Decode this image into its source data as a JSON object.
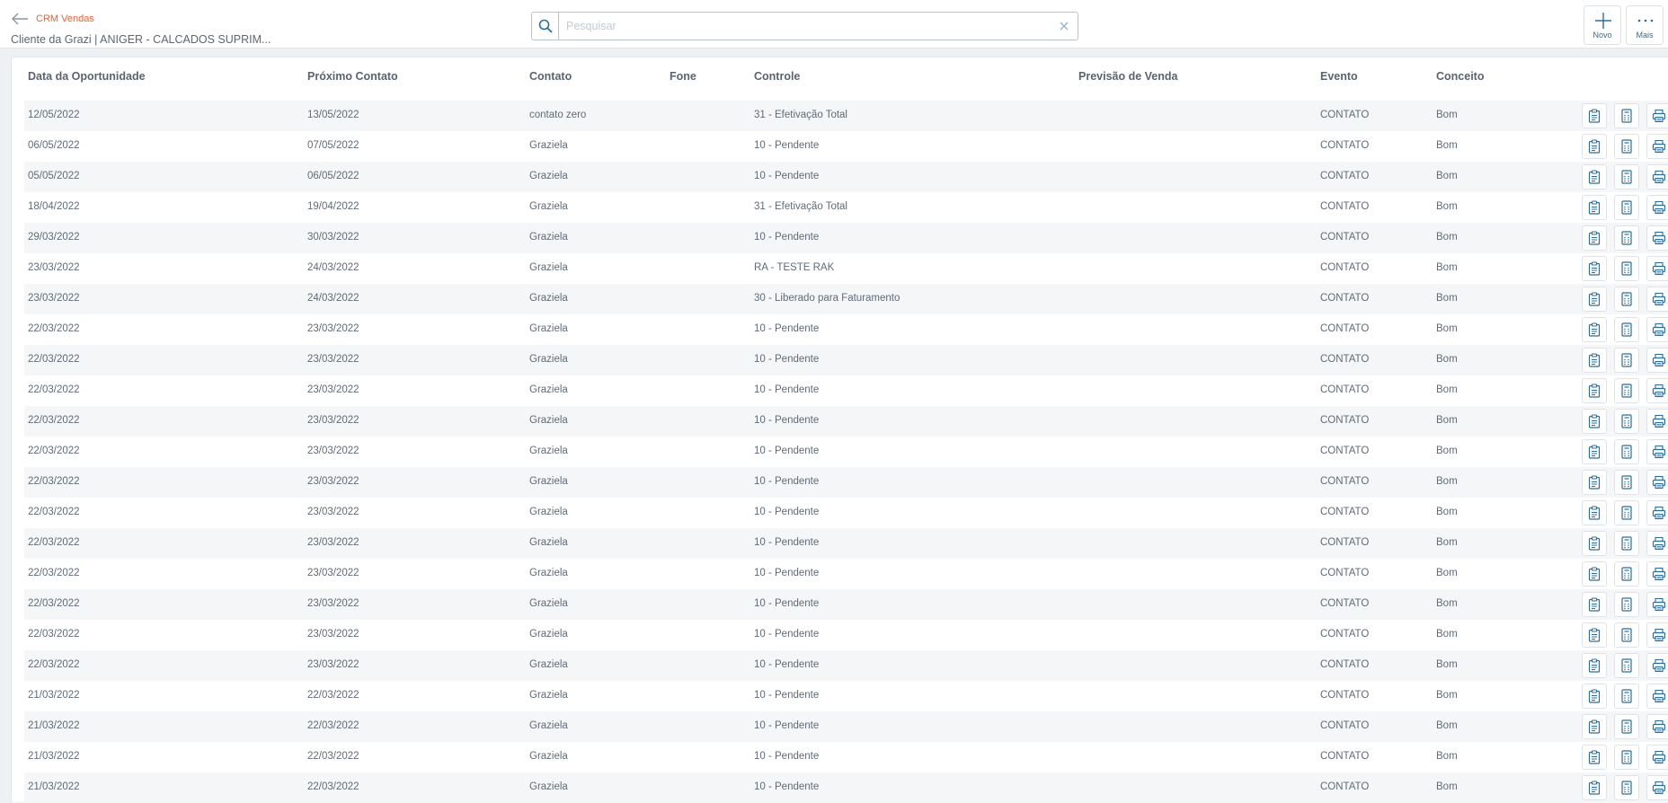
{
  "header": {
    "app_title": "CRM Vendas",
    "subtitle": "Cliente da Grazi | ANIGER - CALCADOS SUPRIM...",
    "search_placeholder": "Pesquisar",
    "novo_label": "Novo",
    "mais_label": "Mais"
  },
  "table": {
    "columns": [
      "Data da Oportunidade",
      "Próximo Contato",
      "Contato",
      "Fone",
      "Controle",
      "Previsão de Venda",
      "Evento",
      "Conceito"
    ],
    "rows": [
      [
        "12/05/2022",
        "13/05/2022",
        "contato zero",
        "",
        "31 - Efetivação Total",
        "",
        "CONTATO",
        "Bom"
      ],
      [
        "06/05/2022",
        "07/05/2022",
        "Graziela",
        "",
        "10 - Pendente",
        "",
        "CONTATO",
        "Bom"
      ],
      [
        "05/05/2022",
        "06/05/2022",
        "Graziela",
        "",
        "10 - Pendente",
        "",
        "CONTATO",
        "Bom"
      ],
      [
        "18/04/2022",
        "19/04/2022",
        "Graziela",
        "",
        "31 - Efetivação Total",
        "",
        "CONTATO",
        "Bom"
      ],
      [
        "29/03/2022",
        "30/03/2022",
        "Graziela",
        "",
        "10 - Pendente",
        "",
        "CONTATO",
        "Bom"
      ],
      [
        "23/03/2022",
        "24/03/2022",
        "Graziela",
        "",
        "RA - TESTE RAK",
        "",
        "CONTATO",
        "Bom"
      ],
      [
        "23/03/2022",
        "24/03/2022",
        "Graziela",
        "",
        "30 - Liberado para Faturamento",
        "",
        "CONTATO",
        "Bom"
      ],
      [
        "22/03/2022",
        "23/03/2022",
        "Graziela",
        "",
        "10 - Pendente",
        "",
        "CONTATO",
        "Bom"
      ],
      [
        "22/03/2022",
        "23/03/2022",
        "Graziela",
        "",
        "10 - Pendente",
        "",
        "CONTATO",
        "Bom"
      ],
      [
        "22/03/2022",
        "23/03/2022",
        "Graziela",
        "",
        "10 - Pendente",
        "",
        "CONTATO",
        "Bom"
      ],
      [
        "22/03/2022",
        "23/03/2022",
        "Graziela",
        "",
        "10 - Pendente",
        "",
        "CONTATO",
        "Bom"
      ],
      [
        "22/03/2022",
        "23/03/2022",
        "Graziela",
        "",
        "10 - Pendente",
        "",
        "CONTATO",
        "Bom"
      ],
      [
        "22/03/2022",
        "23/03/2022",
        "Graziela",
        "",
        "10 - Pendente",
        "",
        "CONTATO",
        "Bom"
      ],
      [
        "22/03/2022",
        "23/03/2022",
        "Graziela",
        "",
        "10 - Pendente",
        "",
        "CONTATO",
        "Bom"
      ],
      [
        "22/03/2022",
        "23/03/2022",
        "Graziela",
        "",
        "10 - Pendente",
        "",
        "CONTATO",
        "Bom"
      ],
      [
        "22/03/2022",
        "23/03/2022",
        "Graziela",
        "",
        "10 - Pendente",
        "",
        "CONTATO",
        "Bom"
      ],
      [
        "22/03/2022",
        "23/03/2022",
        "Graziela",
        "",
        "10 - Pendente",
        "",
        "CONTATO",
        "Bom"
      ],
      [
        "22/03/2022",
        "23/03/2022",
        "Graziela",
        "",
        "10 - Pendente",
        "",
        "CONTATO",
        "Bom"
      ],
      [
        "22/03/2022",
        "23/03/2022",
        "Graziela",
        "",
        "10 - Pendente",
        "",
        "CONTATO",
        "Bom"
      ],
      [
        "21/03/2022",
        "22/03/2022",
        "Graziela",
        "",
        "10 - Pendente",
        "",
        "CONTATO",
        "Bom"
      ],
      [
        "21/03/2022",
        "22/03/2022",
        "Graziela",
        "",
        "10 - Pendente",
        "",
        "CONTATO",
        "Bom"
      ],
      [
        "21/03/2022",
        "22/03/2022",
        "Graziela",
        "",
        "10 - Pendente",
        "",
        "CONTATO",
        "Bom"
      ],
      [
        "21/03/2022",
        "22/03/2022",
        "Graziela",
        "",
        "10 - Pendente",
        "",
        "CONTATO",
        "Bom"
      ]
    ],
    "row_actions": [
      "clipboard-icon",
      "calculator-icon",
      "printer-icon"
    ]
  },
  "colors": {
    "accent": "#f0622d",
    "icon_blue": "#2a6f9b",
    "row_alt": "#f5f6f7"
  }
}
